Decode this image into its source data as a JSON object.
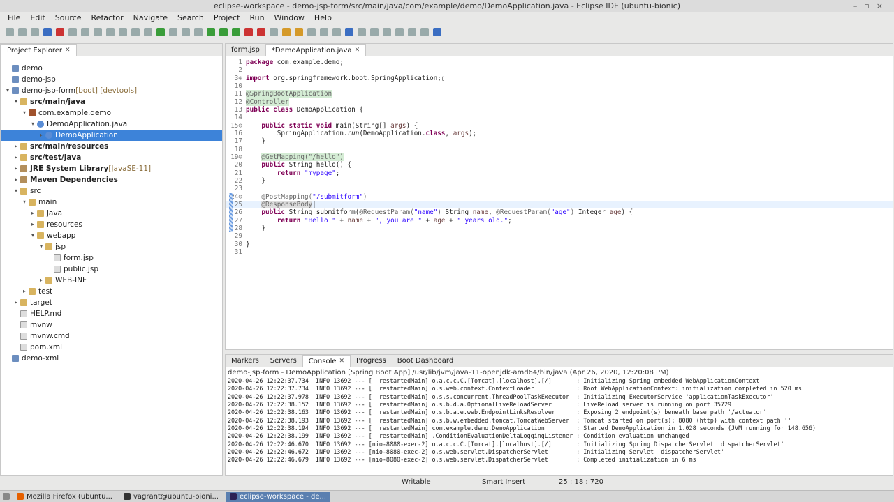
{
  "window": {
    "title": "eclipse-workspace - demo-jsp-form/src/main/java/com/example/demo/DemoApplication.java - Eclipse IDE  (ubuntu-bionic)"
  },
  "menu": [
    "File",
    "Edit",
    "Source",
    "Refactor",
    "Navigate",
    "Search",
    "Project",
    "Run",
    "Window",
    "Help"
  ],
  "explorer": {
    "title": "Project Explorer",
    "items": [
      {
        "label": "demo",
        "depth": 0,
        "arrow": "",
        "icon": "proj"
      },
      {
        "label": "demo-jsp",
        "depth": 0,
        "arrow": "",
        "icon": "proj"
      },
      {
        "label": "demo-jsp-form",
        "deco": " [boot] [devtools]",
        "depth": 0,
        "arrow": "▾",
        "icon": "proj"
      },
      {
        "label": "src/main/java",
        "depth": 1,
        "arrow": "▾",
        "icon": "folder",
        "bold": true
      },
      {
        "label": "com.example.demo",
        "depth": 2,
        "arrow": "▾",
        "icon": "pkg"
      },
      {
        "label": "DemoApplication.java",
        "depth": 3,
        "arrow": "▾",
        "icon": "java"
      },
      {
        "label": "DemoApplication",
        "depth": 4,
        "arrow": "▸",
        "icon": "java",
        "selected": true
      },
      {
        "label": "src/main/resources",
        "depth": 1,
        "arrow": "▸",
        "icon": "folder",
        "bold": true
      },
      {
        "label": "src/test/java",
        "depth": 1,
        "arrow": "▸",
        "icon": "folder",
        "bold": true
      },
      {
        "label": "JRE System Library",
        "deco": " [JavaSE-11]",
        "depth": 1,
        "arrow": "▸",
        "icon": "jar",
        "bold": true
      },
      {
        "label": "Maven Dependencies",
        "depth": 1,
        "arrow": "▸",
        "icon": "jar",
        "bold": true
      },
      {
        "label": "src",
        "depth": 1,
        "arrow": "▾",
        "icon": "folder"
      },
      {
        "label": "main",
        "depth": 2,
        "arrow": "▾",
        "icon": "folder"
      },
      {
        "label": "java",
        "depth": 3,
        "arrow": "▸",
        "icon": "folder"
      },
      {
        "label": "resources",
        "depth": 3,
        "arrow": "▸",
        "icon": "folder"
      },
      {
        "label": "webapp",
        "depth": 3,
        "arrow": "▾",
        "icon": "folder"
      },
      {
        "label": "jsp",
        "depth": 4,
        "arrow": "▾",
        "icon": "folder"
      },
      {
        "label": "form.jsp",
        "depth": 5,
        "arrow": "",
        "icon": "file"
      },
      {
        "label": "public.jsp",
        "depth": 5,
        "arrow": "",
        "icon": "file"
      },
      {
        "label": "WEB-INF",
        "depth": 4,
        "arrow": "▸",
        "icon": "folder"
      },
      {
        "label": "test",
        "depth": 2,
        "arrow": "▸",
        "icon": "folder"
      },
      {
        "label": "target",
        "depth": 1,
        "arrow": "▸",
        "icon": "folder"
      },
      {
        "label": "HELP.md",
        "depth": 1,
        "arrow": "",
        "icon": "file"
      },
      {
        "label": "mvnw",
        "depth": 1,
        "arrow": "",
        "icon": "file"
      },
      {
        "label": "mvnw.cmd",
        "depth": 1,
        "arrow": "",
        "icon": "file"
      },
      {
        "label": "pom.xml",
        "depth": 1,
        "arrow": "",
        "icon": "file"
      },
      {
        "label": "demo-xml",
        "depth": 0,
        "arrow": "",
        "icon": "proj"
      }
    ]
  },
  "editor": {
    "tabs": [
      {
        "label": "form.jsp",
        "active": false
      },
      {
        "label": "*DemoApplication.java",
        "active": true
      }
    ],
    "lines": [
      {
        "n": "1",
        "segs": [
          [
            "package",
            "kw"
          ],
          [
            " com.example.demo;",
            ""
          ]
        ]
      },
      {
        "n": "2",
        "segs": []
      },
      {
        "n": "3⊕",
        "segs": [
          [
            "import",
            "kw"
          ],
          [
            " org.springframework.boot.SpringApplication;▯",
            ""
          ]
        ]
      },
      {
        "n": "10",
        "segs": []
      },
      {
        "n": "11",
        "segs": [
          [
            "@SpringBootApplication",
            "annhl"
          ]
        ]
      },
      {
        "n": "12",
        "segs": [
          [
            "@Controller",
            "annhl"
          ]
        ]
      },
      {
        "n": "13",
        "segs": [
          [
            "public class",
            "kw"
          ],
          [
            " DemoApplication {",
            ""
          ]
        ]
      },
      {
        "n": "14",
        "segs": []
      },
      {
        "n": "15⊖",
        "segs": [
          [
            "    ",
            ""
          ],
          [
            "public static void",
            "kw"
          ],
          [
            " main(String[] ",
            ""
          ],
          [
            "args",
            "var"
          ],
          [
            ") {",
            ""
          ]
        ]
      },
      {
        "n": "16",
        "segs": [
          [
            "        SpringApplication.",
            ""
          ],
          [
            "run",
            "it"
          ],
          [
            "(DemoApplication.",
            ""
          ],
          [
            "class",
            "kw"
          ],
          [
            ", ",
            ""
          ],
          [
            "args",
            "var"
          ],
          [
            ");",
            ""
          ]
        ]
      },
      {
        "n": "17",
        "segs": [
          [
            "    }",
            ""
          ]
        ]
      },
      {
        "n": "18",
        "segs": []
      },
      {
        "n": "19⊖",
        "segs": [
          [
            "    ",
            ""
          ],
          [
            "@GetMapping(\"/hello\")",
            "annhl"
          ]
        ]
      },
      {
        "n": "20",
        "segs": [
          [
            "    ",
            ""
          ],
          [
            "public",
            "kw"
          ],
          [
            " String hello() {",
            ""
          ]
        ]
      },
      {
        "n": "21",
        "segs": [
          [
            "        ",
            ""
          ],
          [
            "return",
            "kw"
          ],
          [
            " ",
            ""
          ],
          [
            "\"mypage\"",
            "str"
          ],
          [
            ";",
            ""
          ]
        ]
      },
      {
        "n": "22",
        "segs": [
          [
            "    }",
            ""
          ]
        ]
      },
      {
        "n": "23",
        "segs": []
      },
      {
        "n": "24⊖",
        "segs": [
          [
            "    ",
            ""
          ],
          [
            "@PostMapping(",
            "ann"
          ],
          [
            "\"/submitform\"",
            "str"
          ],
          [
            ")",
            "ann"
          ]
        ],
        "changed": true
      },
      {
        "n": "25",
        "segs": [
          [
            "    ",
            ""
          ],
          [
            "@ResponseBody",
            "ann2"
          ],
          [
            "|",
            ""
          ]
        ],
        "changed": true,
        "current": true
      },
      {
        "n": "26",
        "segs": [
          [
            "    ",
            ""
          ],
          [
            "public",
            "kw"
          ],
          [
            " String submitform(",
            ""
          ],
          [
            "@RequestParam(",
            "ann"
          ],
          [
            "\"name\"",
            "str"
          ],
          [
            ")",
            "ann"
          ],
          [
            " String ",
            ""
          ],
          [
            "name",
            "var"
          ],
          [
            ", ",
            ""
          ],
          [
            "@RequestParam(",
            "ann"
          ],
          [
            "\"age\"",
            "str"
          ],
          [
            ")",
            "ann"
          ],
          [
            " Integer ",
            ""
          ],
          [
            "age",
            "var"
          ],
          [
            ") {",
            ""
          ]
        ],
        "changed": true
      },
      {
        "n": "27",
        "segs": [
          [
            "        ",
            ""
          ],
          [
            "return",
            "kw"
          ],
          [
            " ",
            ""
          ],
          [
            "\"Hello \"",
            "str"
          ],
          [
            " + ",
            ""
          ],
          [
            "name",
            "var"
          ],
          [
            " + ",
            ""
          ],
          [
            "\", you are \"",
            "str"
          ],
          [
            " + ",
            ""
          ],
          [
            "age",
            "var"
          ],
          [
            " + ",
            ""
          ],
          [
            "\" years old.\"",
            "str"
          ],
          [
            ";",
            ""
          ]
        ],
        "changed": true
      },
      {
        "n": "28",
        "segs": [
          [
            "    }",
            ""
          ]
        ],
        "changed": true
      },
      {
        "n": "29",
        "segs": []
      },
      {
        "n": "30",
        "segs": [
          [
            "}",
            ""
          ]
        ]
      },
      {
        "n": "31",
        "segs": []
      }
    ]
  },
  "bottom": {
    "tabs": [
      "Markers",
      "Servers",
      "Console",
      "Progress",
      "Boot Dashboard"
    ],
    "active": "Console",
    "header": "demo-jsp-form - DemoApplication [Spring Boot App] /usr/lib/jvm/java-11-openjdk-amd64/bin/java  (Apr 26, 2020, 12:20:08 PM)",
    "lines": [
      "2020-04-26 12:22:37.734  INFO 13692 --- [  restartedMain] o.a.c.c.C.[Tomcat].[localhost].[/]       : Initializing Spring embedded WebApplicationContext",
      "2020-04-26 12:22:37.734  INFO 13692 --- [  restartedMain] o.s.web.context.ContextLoader            : Root WebApplicationContext: initialization completed in 520 ms",
      "2020-04-26 12:22:37.978  INFO 13692 --- [  restartedMain] o.s.s.concurrent.ThreadPoolTaskExecutor  : Initializing ExecutorService 'applicationTaskExecutor'",
      "2020-04-26 12:22:38.152  INFO 13692 --- [  restartedMain] o.s.b.d.a.OptionalLiveReloadServer       : LiveReload server is running on port 35729",
      "2020-04-26 12:22:38.163  INFO 13692 --- [  restartedMain] o.s.b.a.e.web.EndpointLinksResolver      : Exposing 2 endpoint(s) beneath base path '/actuator'",
      "2020-04-26 12:22:38.193  INFO 13692 --- [  restartedMain] o.s.b.w.embedded.tomcat.TomcatWebServer  : Tomcat started on port(s): 8080 (http) with context path ''",
      "2020-04-26 12:22:38.194  INFO 13692 --- [  restartedMain] com.example.demo.DemoApplication         : Started DemoApplication in 1.028 seconds (JVM running for 148.656)",
      "2020-04-26 12:22:38.199  INFO 13692 --- [  restartedMain] .ConditionEvaluationDeltaLoggingListener : Condition evaluation unchanged",
      "2020-04-26 12:22:46.670  INFO 13692 --- [nio-8080-exec-2] o.a.c.c.C.[Tomcat].[localhost].[/]       : Initializing Spring DispatcherServlet 'dispatcherServlet'",
      "2020-04-26 12:22:46.672  INFO 13692 --- [nio-8080-exec-2] o.s.web.servlet.DispatcherServlet        : Initializing Servlet 'dispatcherServlet'",
      "2020-04-26 12:22:46.679  INFO 13692 --- [nio-8080-exec-2] o.s.web.servlet.DispatcherServlet        : Completed initialization in 6 ms"
    ]
  },
  "status": {
    "mode": "Writable",
    "insert": "Smart Insert",
    "position": "25 : 18 : 720"
  },
  "taskbar": [
    {
      "label": "Mozilla Firefox (ubuntu...",
      "color": "#e66000"
    },
    {
      "label": "vagrant@ubuntu-bioni...",
      "color": "#333"
    },
    {
      "label": "eclipse-workspace - de...",
      "color": "#2c2255",
      "active": true
    }
  ]
}
